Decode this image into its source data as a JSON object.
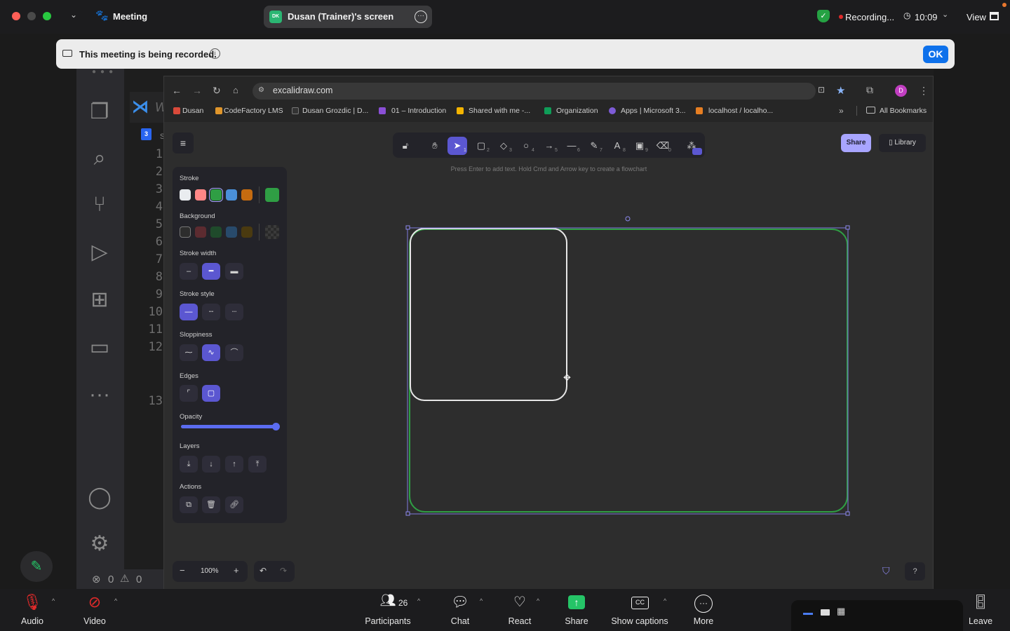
{
  "topbar": {
    "meeting_label": "Meeting",
    "screen_label": "Dusan (Trainer)'s screen",
    "screen_avatar": "DK",
    "recording_label": "Recording...",
    "time": "10:09",
    "view_label": "View"
  },
  "banner": {
    "text": "This meeting is being recorded.",
    "ok_label": "OK"
  },
  "vscode": {
    "title_initial": "W",
    "tab_initial": "s",
    "line_numbers": [
      "1",
      "2",
      "3",
      "4",
      "5",
      "6",
      "7",
      "8",
      "9",
      "10",
      "11",
      "12",
      "13"
    ],
    "errors": "0",
    "warnings": "0"
  },
  "browser": {
    "url": "excalidraw.com",
    "profile_initial": "D",
    "bookmarks": [
      {
        "label": "Dusan"
      },
      {
        "label": "CodeFactory LMS"
      },
      {
        "label": "Dusan Grozdic | D..."
      },
      {
        "label": "01 – Introduction"
      },
      {
        "label": "Shared with me -..."
      },
      {
        "label": "Organization"
      },
      {
        "label": "Apps | Microsoft 3..."
      },
      {
        "label": "localhost / localho..."
      }
    ],
    "all_bookmarks": "All Bookmarks"
  },
  "excalidraw": {
    "hint": "Press Enter to add text. Hold Cmd and Arrow key to create a flowchart",
    "share_label": "Share",
    "library_label": "Library",
    "tool_numbers": [
      "1",
      "2",
      "3",
      "4",
      "5",
      "6",
      "7",
      "8",
      "9",
      "0"
    ],
    "props": {
      "stroke": "Stroke",
      "background": "Background",
      "stroke_width": "Stroke width",
      "stroke_style": "Stroke style",
      "sloppiness": "Sloppiness",
      "edges": "Edges",
      "opacity": "Opacity",
      "opacity_value": 1.0,
      "layers": "Layers",
      "actions": "Actions"
    },
    "stroke_colors": [
      "#e9ecef",
      "#ff8787",
      "#2f9e44",
      "#4a90d9",
      "#c56b10"
    ],
    "stroke_current": "#2f9e44",
    "bg_colors": [
      "#2d2d2d",
      "#5c2b30",
      "#1f4a2b",
      "#284a6b",
      "#4a3a10"
    ],
    "zoom": "100%"
  },
  "bottombar": {
    "audio": "Audio",
    "video": "Video",
    "participants": "Participants",
    "participants_count": "26",
    "chat": "Chat",
    "react": "React",
    "share": "Share",
    "captions": "Show captions",
    "more": "More",
    "leave": "Leave"
  }
}
